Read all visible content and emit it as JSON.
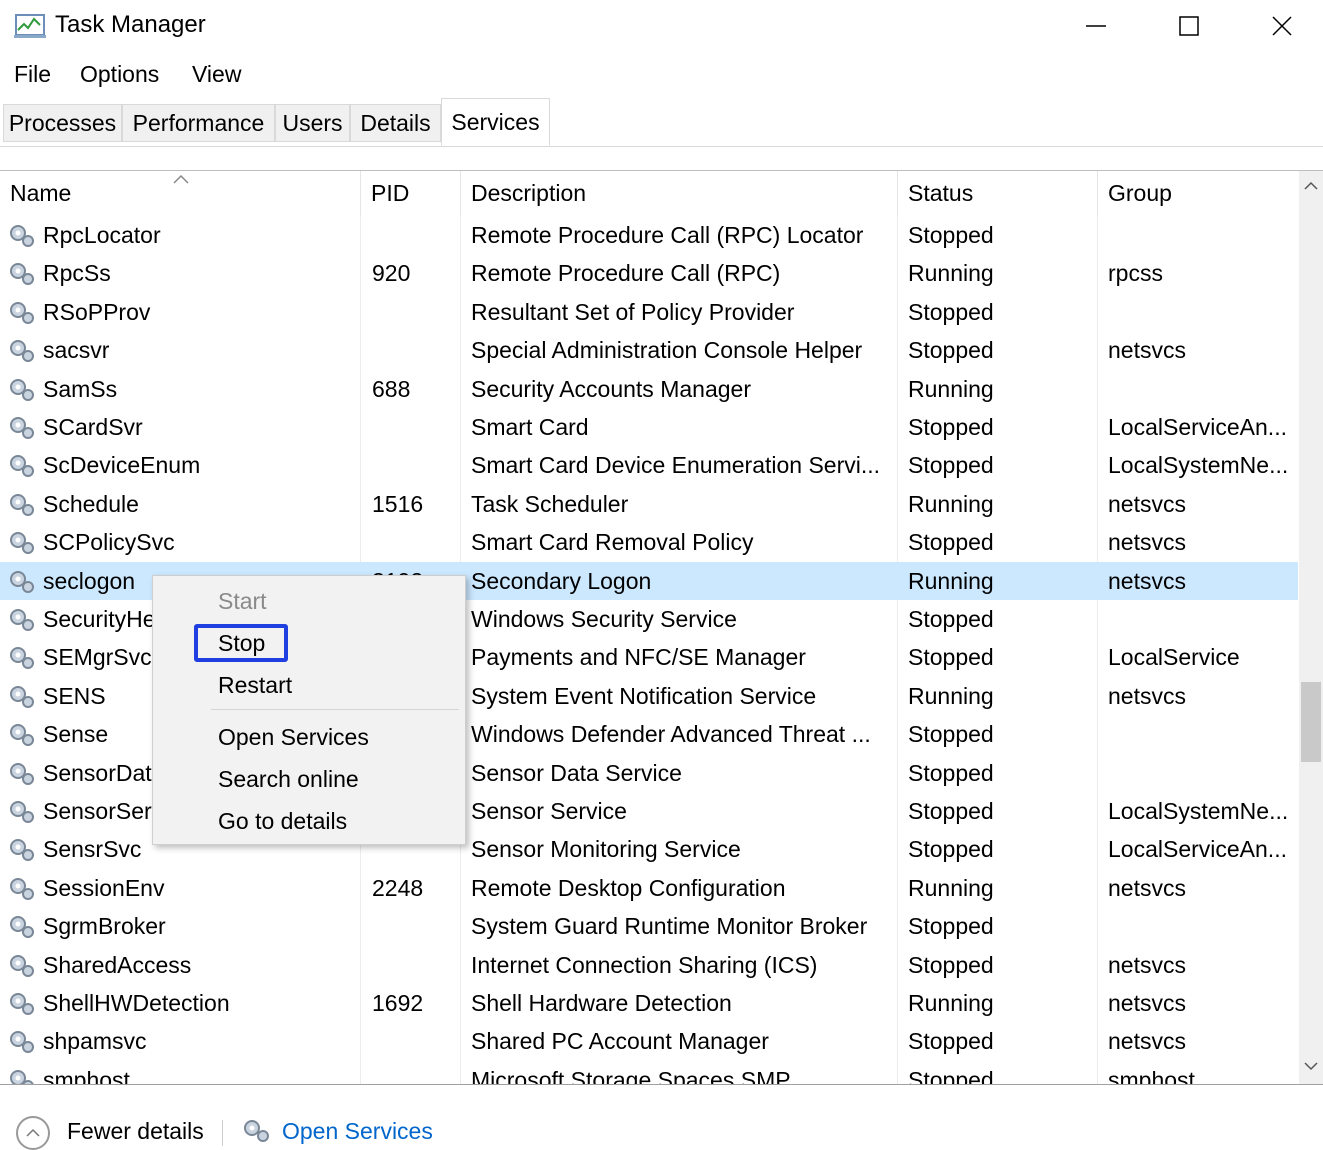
{
  "window": {
    "title": "Task Manager",
    "controls": {
      "minimize": "minimize",
      "maximize": "maximize",
      "close": "close"
    }
  },
  "menu": [
    "File",
    "Options",
    "View"
  ],
  "tabs": [
    {
      "label": "Processes",
      "active": false
    },
    {
      "label": "Performance",
      "active": false
    },
    {
      "label": "Users",
      "active": false
    },
    {
      "label": "Details",
      "active": false
    },
    {
      "label": "Services",
      "active": true
    }
  ],
  "table": {
    "columns": [
      "Name",
      "PID",
      "Description",
      "Status",
      "Group"
    ],
    "sorted_column": "Name",
    "rows": [
      {
        "name": "RpcLocator",
        "pid": "",
        "description": "Remote Procedure Call (RPC) Locator",
        "status": "Stopped",
        "group": ""
      },
      {
        "name": "RpcSs",
        "pid": "920",
        "description": "Remote Procedure Call (RPC)",
        "status": "Running",
        "group": "rpcss"
      },
      {
        "name": "RSoPProv",
        "pid": "",
        "description": "Resultant Set of Policy Provider",
        "status": "Stopped",
        "group": ""
      },
      {
        "name": "sacsvr",
        "pid": "",
        "description": "Special Administration Console Helper",
        "status": "Stopped",
        "group": "netsvcs"
      },
      {
        "name": "SamSs",
        "pid": "688",
        "description": "Security Accounts Manager",
        "status": "Running",
        "group": ""
      },
      {
        "name": "SCardSvr",
        "pid": "",
        "description": "Smart Card",
        "status": "Stopped",
        "group": "LocalServiceAn..."
      },
      {
        "name": "ScDeviceEnum",
        "pid": "",
        "description": "Smart Card Device Enumeration Servi...",
        "status": "Stopped",
        "group": "LocalSystemNe..."
      },
      {
        "name": "Schedule",
        "pid": "1516",
        "description": "Task Scheduler",
        "status": "Running",
        "group": "netsvcs"
      },
      {
        "name": "SCPolicySvc",
        "pid": "",
        "description": "Smart Card Removal Policy",
        "status": "Stopped",
        "group": "netsvcs"
      },
      {
        "name": "seclogon",
        "pid": "3192",
        "description": "Secondary Logon",
        "status": "Running",
        "group": "netsvcs",
        "selected": true
      },
      {
        "name": "SecurityHealthService",
        "pid": "",
        "description": "Windows Security Service",
        "status": "Stopped",
        "group": ""
      },
      {
        "name": "SEMgrSvc",
        "pid": "",
        "description": "Payments and NFC/SE Manager",
        "status": "Stopped",
        "group": "LocalService"
      },
      {
        "name": "SENS",
        "pid": "",
        "description": "System Event Notification Service",
        "status": "Running",
        "group": "netsvcs"
      },
      {
        "name": "Sense",
        "pid": "",
        "description": "Windows Defender Advanced Threat ...",
        "status": "Stopped",
        "group": ""
      },
      {
        "name": "SensorDataService",
        "pid": "",
        "description": "Sensor Data Service",
        "status": "Stopped",
        "group": ""
      },
      {
        "name": "SensorService",
        "pid": "",
        "description": "Sensor Service",
        "status": "Stopped",
        "group": "LocalSystemNe..."
      },
      {
        "name": "SensrSvc",
        "pid": "",
        "description": "Sensor Monitoring Service",
        "status": "Stopped",
        "group": "LocalServiceAn..."
      },
      {
        "name": "SessionEnv",
        "pid": "2248",
        "description": "Remote Desktop Configuration",
        "status": "Running",
        "group": "netsvcs"
      },
      {
        "name": "SgrmBroker",
        "pid": "",
        "description": "System Guard Runtime Monitor Broker",
        "status": "Stopped",
        "group": ""
      },
      {
        "name": "SharedAccess",
        "pid": "",
        "description": "Internet Connection Sharing (ICS)",
        "status": "Stopped",
        "group": "netsvcs"
      },
      {
        "name": "ShellHWDetection",
        "pid": "1692",
        "description": "Shell Hardware Detection",
        "status": "Running",
        "group": "netsvcs"
      },
      {
        "name": "shpamsvc",
        "pid": "",
        "description": "Shared PC Account Manager",
        "status": "Stopped",
        "group": "netsvcs"
      },
      {
        "name": "smphost",
        "pid": "",
        "description": "Microsoft Storage Spaces SMP",
        "status": "Stopped",
        "group": "smphost"
      }
    ]
  },
  "context_menu": {
    "items": [
      {
        "label": "Start",
        "enabled": false
      },
      {
        "label": "Stop",
        "enabled": true,
        "highlighted": true
      },
      {
        "label": "Restart",
        "enabled": true
      },
      {
        "label": "Open Services",
        "enabled": true
      },
      {
        "label": "Search online",
        "enabled": true
      },
      {
        "label": "Go to details",
        "enabled": true
      }
    ]
  },
  "footer": {
    "fewer_details": "Fewer details",
    "open_services": "Open Services"
  },
  "colors": {
    "selected_row": "#cce8ff",
    "highlight_border": "#1f3fe0",
    "link": "#0066cc"
  }
}
